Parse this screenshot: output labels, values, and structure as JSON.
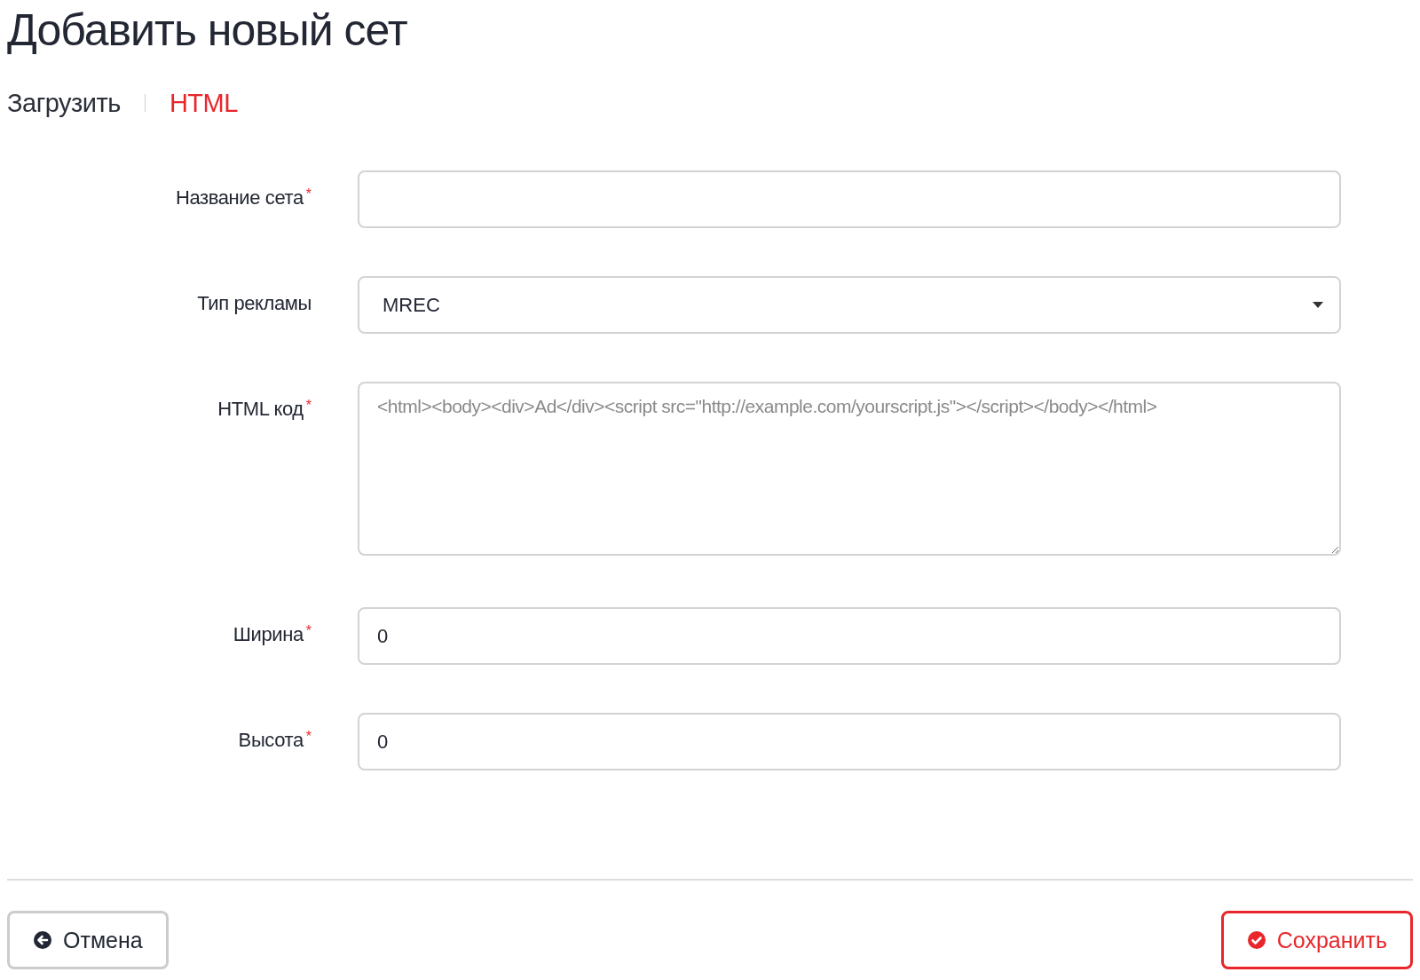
{
  "title": "Добавить новый сет",
  "tabs": [
    {
      "label": "Загрузить",
      "selected": false
    },
    {
      "label": "HTML",
      "selected": true
    }
  ],
  "fields": [
    {
      "kind": "text",
      "label": "Название сета",
      "required_mark": "*"
    },
    {
      "kind": "select",
      "label": "Тип рекламы",
      "value": "MREC"
    },
    {
      "kind": "textarea",
      "label": "HTML код",
      "required_mark": "*",
      "placeholder": "<html><body><div>Ad</div><script src=\"http://example.com/yourscript.js\"></script></body></html>"
    },
    {
      "kind": "text",
      "label": "Ширина",
      "required_mark": "*",
      "value": "0"
    },
    {
      "kind": "text",
      "label": "Высота",
      "required_mark": "*",
      "value": "0"
    }
  ],
  "buttons": [
    {
      "kind": "cancel",
      "label": "Отмена"
    },
    {
      "kind": "save",
      "label": "Сохранить"
    }
  ]
}
